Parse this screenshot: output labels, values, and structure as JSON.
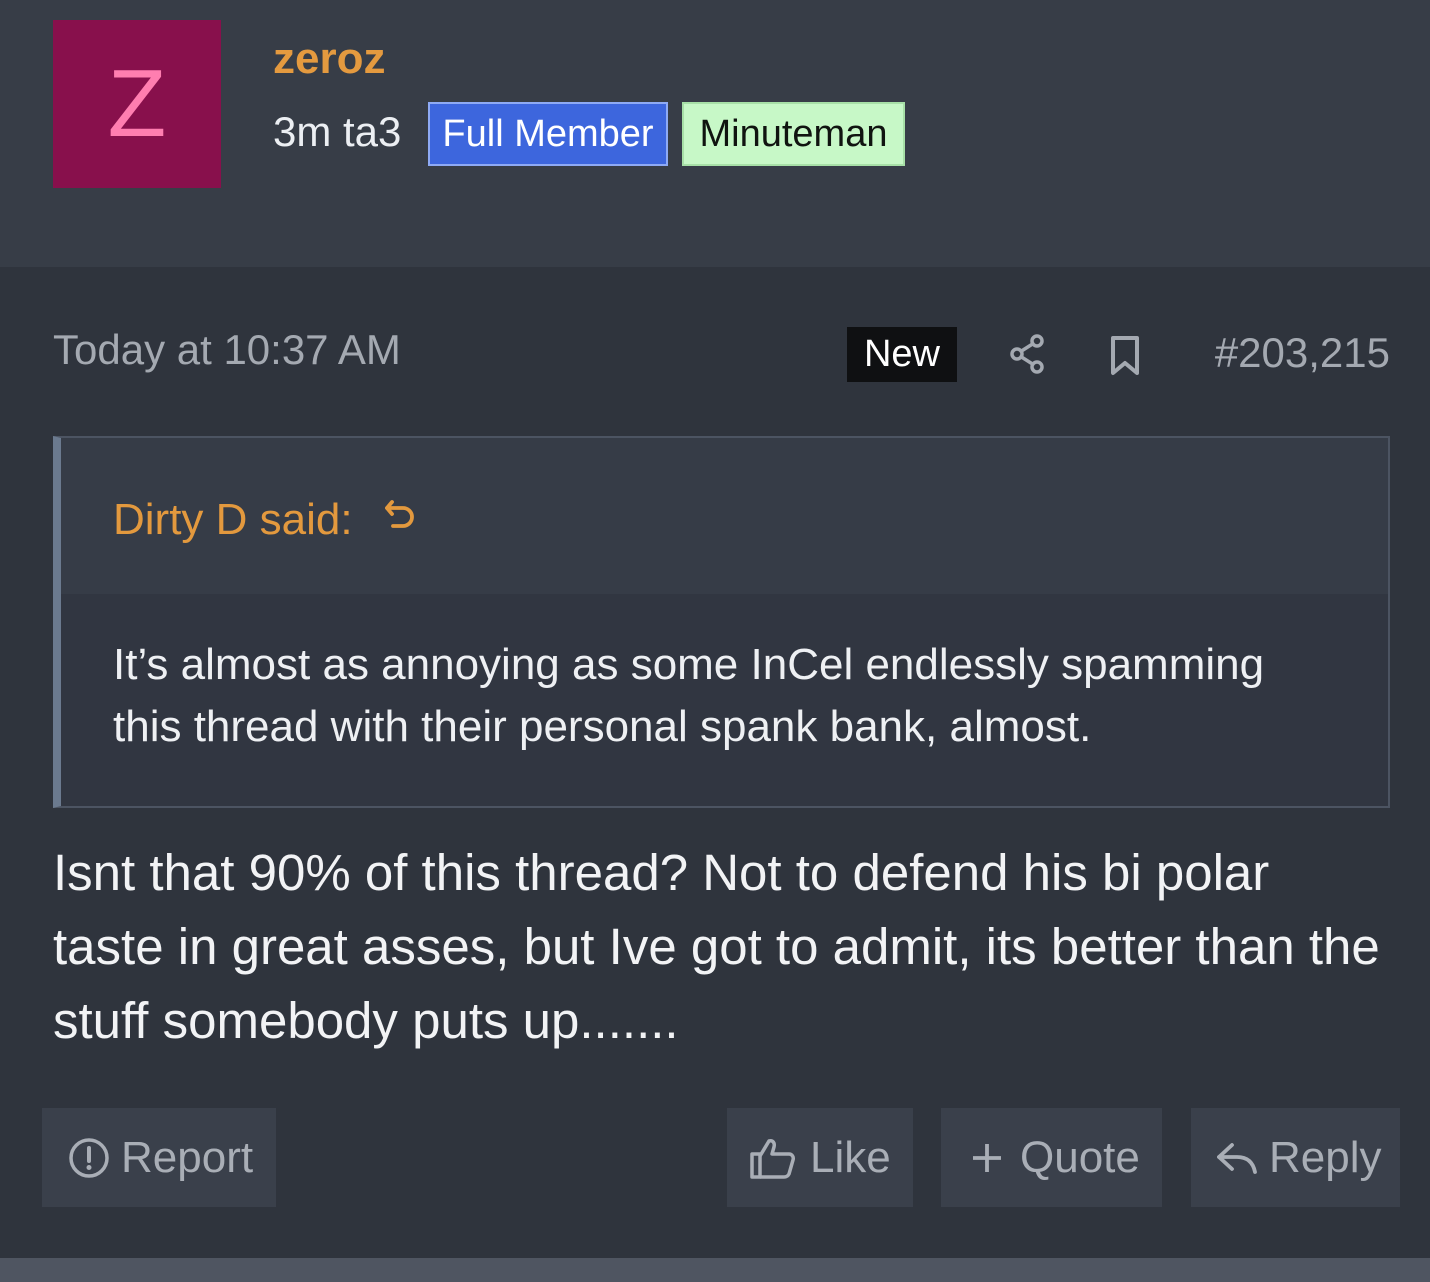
{
  "user": {
    "avatar_letter": "Z",
    "avatar_bg": "#88104c",
    "avatar_fg": "#ff7eb0",
    "username": "zeroz",
    "title": "3m ta3",
    "badges": [
      {
        "label": "Full Member",
        "color": "#3d66dd"
      },
      {
        "label": "Minuteman",
        "color": "#c7f8c7"
      }
    ]
  },
  "post": {
    "timestamp": "Today at 10:37 AM",
    "new_label": "New",
    "share_icon": "share-icon",
    "bookmark_icon": "bookmark-icon",
    "number": "#203,215",
    "quote": {
      "attribution": "Dirty D said:",
      "jump_icon": "go-to-original-icon",
      "text": "It’s almost as annoying as some InCel endlessly spamming this thread with their personal spank bank, almost."
    },
    "message": "Isnt that 90% of this thread? Not to defend his bi polar taste in great asses, but Ive got to admit, its better than the stuff somebody puts up.......",
    "actions": {
      "report": "Report",
      "like": "Like",
      "quote": "Quote",
      "reply": "Reply"
    }
  }
}
